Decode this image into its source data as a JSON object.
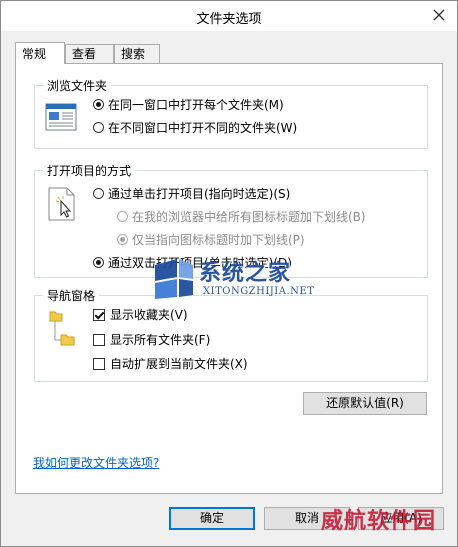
{
  "window": {
    "title": "文件夹选项"
  },
  "tabs": [
    {
      "label": "常规",
      "active": true
    },
    {
      "label": "查看",
      "active": false
    },
    {
      "label": "搜索",
      "active": false
    }
  ],
  "browse": {
    "title": "浏览文件夹",
    "options": [
      {
        "label": "在同一窗口中打开每个文件夹(M)",
        "checked": true
      },
      {
        "label": "在不同窗口中打开不同的文件夹(W)",
        "checked": false
      }
    ]
  },
  "click": {
    "title": "打开项目的方式",
    "single": {
      "label": "通过单击打开项目(指向时选定)(S)",
      "checked": false
    },
    "sub": [
      {
        "label": "在我的浏览器中给所有图标标题加下划线(B)",
        "checked": false,
        "disabled": true
      },
      {
        "label": "仅当指向图标标题时加下划线(P)",
        "checked": true,
        "disabled": true
      }
    ],
    "double": {
      "label": "通过双击打开项目(单击时选定)(D)",
      "checked": true
    }
  },
  "nav": {
    "title": "导航窗格",
    "options": [
      {
        "label": "显示收藏夹(V)",
        "checked": true
      },
      {
        "label": "显示所有文件夹(F)",
        "checked": false
      },
      {
        "label": "自动扩展到当前文件夹(X)",
        "checked": false
      }
    ]
  },
  "restore_label": "还原默认值(R)",
  "help_link": "我如何更改文件夹选项?",
  "buttons": {
    "ok": "确定",
    "cancel": "取消",
    "apply": "应用(A)"
  },
  "watermark": {
    "brand_cn": "系统之家",
    "brand_en": "XITONGZHIJIA.NET",
    "corner": "威航软件园"
  }
}
